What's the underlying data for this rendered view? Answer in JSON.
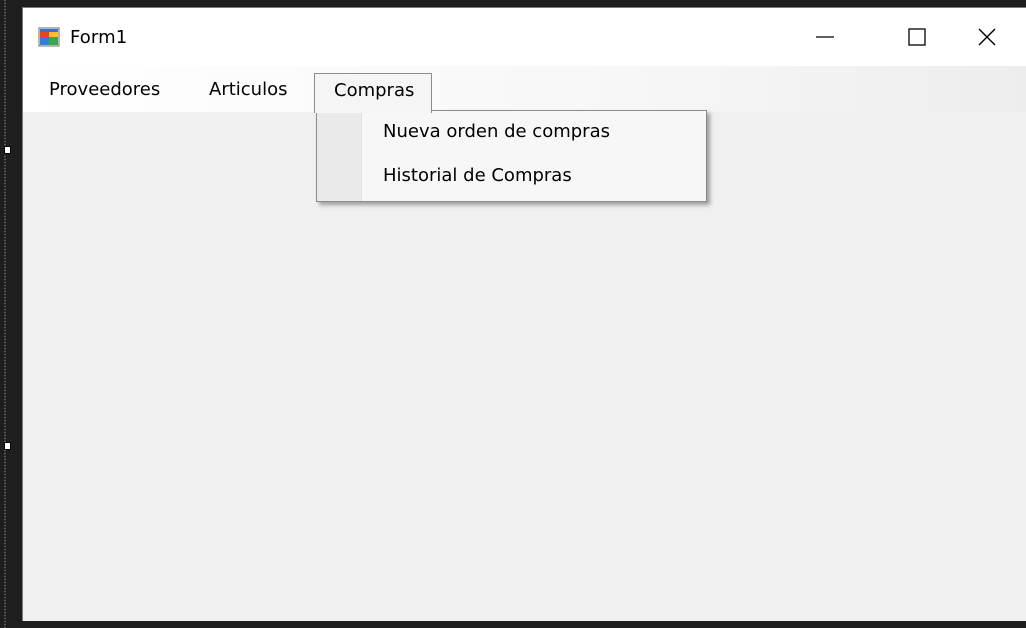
{
  "window": {
    "title": "Form1",
    "icon": "winforms-app-icon",
    "controls": {
      "minimize": "minimize-icon",
      "maximize": "maximize-icon",
      "close": "close-icon"
    }
  },
  "menubar": {
    "items": [
      {
        "label": "Proveedores"
      },
      {
        "label": "Articulos"
      },
      {
        "label": "Compras",
        "open": true
      }
    ]
  },
  "dropdown": {
    "items": [
      {
        "label": "Nueva orden de compras"
      },
      {
        "label": "Historial de Compras"
      }
    ]
  },
  "colors": {
    "client_area": "#f0f0f0",
    "titlebar": "#ffffff",
    "designer_background": "#1e1e1e"
  }
}
